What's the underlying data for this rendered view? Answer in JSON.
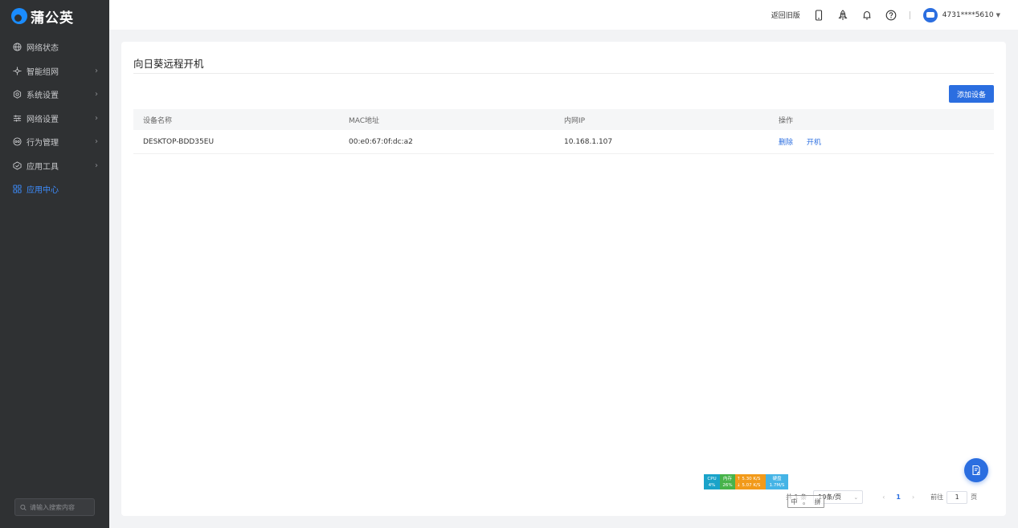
{
  "brand": {
    "name": "蒲公英",
    "accent": "#2b6ee0"
  },
  "sidebar": {
    "items": [
      {
        "label": "网络状态",
        "icon": "globe-icon",
        "has_children": false,
        "active": false
      },
      {
        "label": "智能组网",
        "icon": "network-icon",
        "has_children": true,
        "active": false
      },
      {
        "label": "系统设置",
        "icon": "gear-icon",
        "has_children": true,
        "active": false
      },
      {
        "label": "网络设置",
        "icon": "sliders-icon",
        "has_children": true,
        "active": false
      },
      {
        "label": "行为管理",
        "icon": "eye-icon",
        "has_children": true,
        "active": false
      },
      {
        "label": "应用工具",
        "icon": "shield-icon",
        "has_children": true,
        "active": false
      },
      {
        "label": "应用中心",
        "icon": "grid-icon",
        "has_children": false,
        "active": true
      }
    ],
    "search_placeholder": "请输入搜索内容"
  },
  "topbar": {
    "back_label": "返回旧版",
    "icons": [
      "mobile-icon",
      "rocket-icon",
      "bell-icon",
      "help-icon"
    ],
    "user_id": "4731****5610"
  },
  "main": {
    "title": "向日葵远程开机",
    "add_button": "添加设备",
    "table": {
      "columns": [
        "设备名称",
        "MAC地址",
        "内网IP",
        "操作"
      ],
      "rows": [
        {
          "name": "DESKTOP-BDD35EU",
          "mac": "00:e0:67:0f:dc:a2",
          "ip": "10.168.1.107",
          "actions": [
            "删除",
            "开机"
          ]
        }
      ]
    },
    "pagination": {
      "total_text": "共 1 条",
      "page_size": "10条/页",
      "current_page": "1",
      "goto_label": "前往",
      "goto_value": "1",
      "page_suffix": "页"
    }
  },
  "monitor": {
    "cpu_label": "CPU",
    "cpu_value": "4%",
    "mem_label": "内存",
    "mem_value": "26%",
    "up_value": "5.30 K/S",
    "down_value": "5.07 K/S",
    "disk_label": "硬盘",
    "disk_value": "1.7M/S"
  },
  "ime": {
    "chars": [
      "中",
      "。",
      "拼"
    ]
  }
}
